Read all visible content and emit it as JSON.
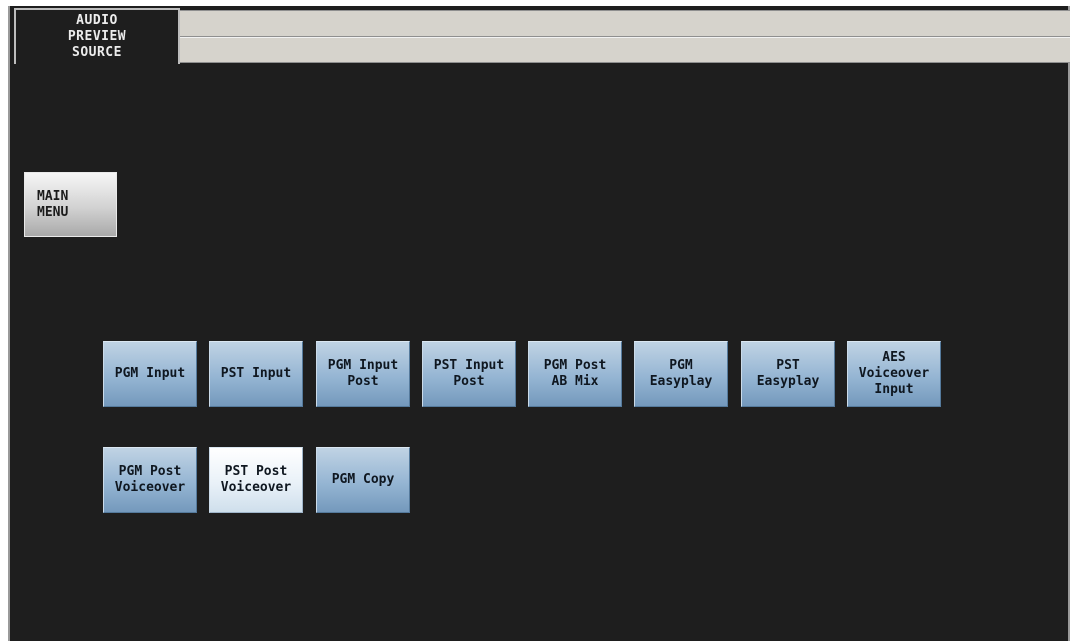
{
  "tab": {
    "label": "AUDIO\nPREVIEW\nSOURCE"
  },
  "main_menu": {
    "label": "MAIN\nMENU"
  },
  "sources": [
    {
      "label": "PGM Input",
      "selected": false
    },
    {
      "label": "PST Input",
      "selected": false
    },
    {
      "label": "PGM Input\nPost",
      "selected": false
    },
    {
      "label": "PST Input\nPost",
      "selected": false
    },
    {
      "label": "PGM Post\nAB Mix",
      "selected": false
    },
    {
      "label": "PGM\nEasyplay",
      "selected": false
    },
    {
      "label": "PST\nEasyplay",
      "selected": false
    },
    {
      "label": "AES\nVoiceover\nInput",
      "selected": false
    },
    {
      "label": "PGM Post\nVoiceover",
      "selected": false
    },
    {
      "label": "PST Post\nVoiceover",
      "selected": true
    },
    {
      "label": "PGM Copy",
      "selected": false
    }
  ]
}
